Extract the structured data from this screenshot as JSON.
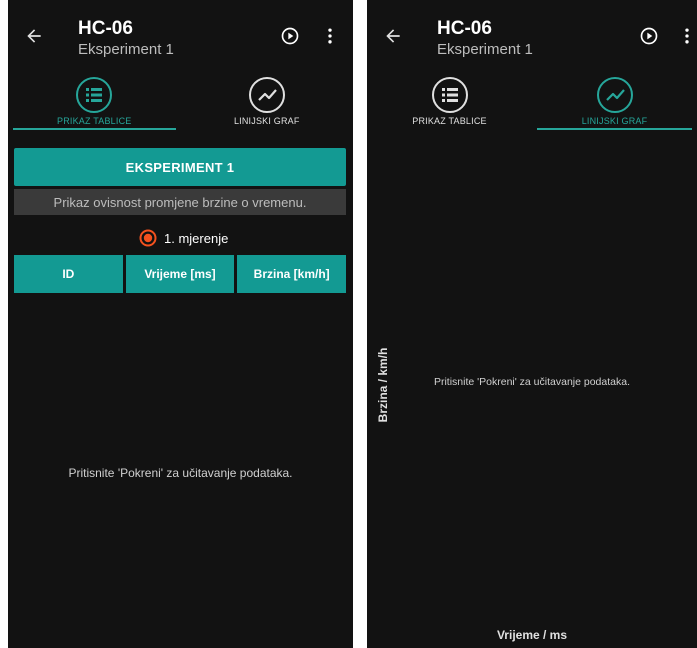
{
  "app": {
    "title": "HC-06",
    "subtitle": "Eksperiment 1"
  },
  "tabs": [
    {
      "label": "PRIKAZ TABLICE",
      "icon": "list-icon"
    },
    {
      "label": "LINIJSKI GRAF",
      "icon": "line-chart-icon"
    }
  ],
  "table_view": {
    "experiment_button": "EKSPERIMENT 1",
    "description": "Prikaz ovisnost promjene brzine o vremenu.",
    "measurement_option": "1. mjerenje",
    "columns": [
      "ID",
      "Vrijeme [ms]",
      "Brzina [km/h]"
    ],
    "empty_message": "Pritisnite 'Pokreni' za učitavanje podataka."
  },
  "graph_view": {
    "y_axis_label": "Brzina / km/h",
    "x_axis_label": "Vrijeme / ms",
    "empty_message": "Pritisnite 'Pokreni' za učitavanje podataka."
  },
  "colors": {
    "accent": "#26a69a",
    "button": "#139a93",
    "background": "#121212",
    "radio": "#f4511e"
  }
}
